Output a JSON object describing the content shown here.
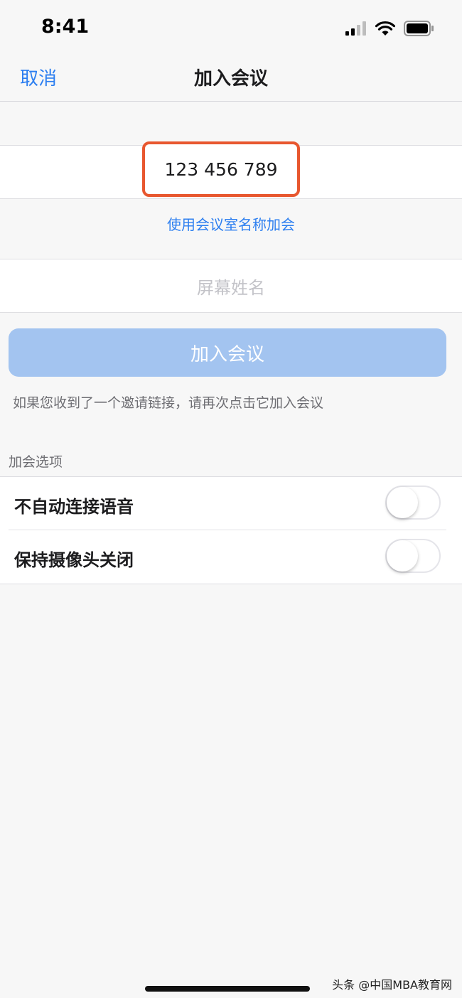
{
  "status_bar": {
    "time": "8:41",
    "icons": [
      "signal-icon",
      "wifi-icon",
      "battery-icon"
    ]
  },
  "nav": {
    "cancel_label": "取消",
    "title": "加入会议"
  },
  "meeting_id": {
    "value": "123 456 789"
  },
  "room_name_link": "使用会议室名称加会",
  "screen_name": {
    "placeholder": "屏幕姓名"
  },
  "join_button_label": "加入会议",
  "hint": "如果您收到了一个邀请链接，请再次点击它加入会议",
  "options": {
    "header": "加会选项",
    "items": [
      {
        "label": "不自动连接语音",
        "on": false
      },
      {
        "label": "保持摄像头关闭",
        "on": false
      }
    ]
  },
  "watermark": "头条 @中国MBA教育网",
  "colors": {
    "accent": "#2d7ff0",
    "highlight_border": "#e8572f",
    "join_disabled": "#a3c4f0"
  }
}
